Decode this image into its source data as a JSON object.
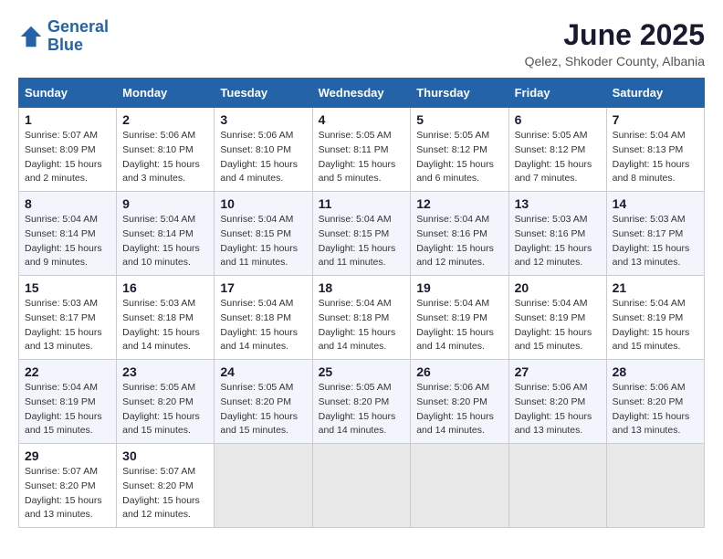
{
  "logo": {
    "line1": "General",
    "line2": "Blue"
  },
  "title": "June 2025",
  "subtitle": "Qelez, Shkoder County, Albania",
  "weekdays": [
    "Sunday",
    "Monday",
    "Tuesday",
    "Wednesday",
    "Thursday",
    "Friday",
    "Saturday"
  ],
  "weeks": [
    [
      {
        "day": "1",
        "sunrise": "5:07 AM",
        "sunset": "8:09 PM",
        "daylight": "15 hours and 2 minutes."
      },
      {
        "day": "2",
        "sunrise": "5:06 AM",
        "sunset": "8:10 PM",
        "daylight": "15 hours and 3 minutes."
      },
      {
        "day": "3",
        "sunrise": "5:06 AM",
        "sunset": "8:10 PM",
        "daylight": "15 hours and 4 minutes."
      },
      {
        "day": "4",
        "sunrise": "5:05 AM",
        "sunset": "8:11 PM",
        "daylight": "15 hours and 5 minutes."
      },
      {
        "day": "5",
        "sunrise": "5:05 AM",
        "sunset": "8:12 PM",
        "daylight": "15 hours and 6 minutes."
      },
      {
        "day": "6",
        "sunrise": "5:05 AM",
        "sunset": "8:12 PM",
        "daylight": "15 hours and 7 minutes."
      },
      {
        "day": "7",
        "sunrise": "5:04 AM",
        "sunset": "8:13 PM",
        "daylight": "15 hours and 8 minutes."
      }
    ],
    [
      {
        "day": "8",
        "sunrise": "5:04 AM",
        "sunset": "8:14 PM",
        "daylight": "15 hours and 9 minutes."
      },
      {
        "day": "9",
        "sunrise": "5:04 AM",
        "sunset": "8:14 PM",
        "daylight": "15 hours and 10 minutes."
      },
      {
        "day": "10",
        "sunrise": "5:04 AM",
        "sunset": "8:15 PM",
        "daylight": "15 hours and 11 minutes."
      },
      {
        "day": "11",
        "sunrise": "5:04 AM",
        "sunset": "8:15 PM",
        "daylight": "15 hours and 11 minutes."
      },
      {
        "day": "12",
        "sunrise": "5:04 AM",
        "sunset": "8:16 PM",
        "daylight": "15 hours and 12 minutes."
      },
      {
        "day": "13",
        "sunrise": "5:03 AM",
        "sunset": "8:16 PM",
        "daylight": "15 hours and 12 minutes."
      },
      {
        "day": "14",
        "sunrise": "5:03 AM",
        "sunset": "8:17 PM",
        "daylight": "15 hours and 13 minutes."
      }
    ],
    [
      {
        "day": "15",
        "sunrise": "5:03 AM",
        "sunset": "8:17 PM",
        "daylight": "15 hours and 13 minutes."
      },
      {
        "day": "16",
        "sunrise": "5:03 AM",
        "sunset": "8:18 PM",
        "daylight": "15 hours and 14 minutes."
      },
      {
        "day": "17",
        "sunrise": "5:04 AM",
        "sunset": "8:18 PM",
        "daylight": "15 hours and 14 minutes."
      },
      {
        "day": "18",
        "sunrise": "5:04 AM",
        "sunset": "8:18 PM",
        "daylight": "15 hours and 14 minutes."
      },
      {
        "day": "19",
        "sunrise": "5:04 AM",
        "sunset": "8:19 PM",
        "daylight": "15 hours and 14 minutes."
      },
      {
        "day": "20",
        "sunrise": "5:04 AM",
        "sunset": "8:19 PM",
        "daylight": "15 hours and 15 minutes."
      },
      {
        "day": "21",
        "sunrise": "5:04 AM",
        "sunset": "8:19 PM",
        "daylight": "15 hours and 15 minutes."
      }
    ],
    [
      {
        "day": "22",
        "sunrise": "5:04 AM",
        "sunset": "8:19 PM",
        "daylight": "15 hours and 15 minutes."
      },
      {
        "day": "23",
        "sunrise": "5:05 AM",
        "sunset": "8:20 PM",
        "daylight": "15 hours and 15 minutes."
      },
      {
        "day": "24",
        "sunrise": "5:05 AM",
        "sunset": "8:20 PM",
        "daylight": "15 hours and 15 minutes."
      },
      {
        "day": "25",
        "sunrise": "5:05 AM",
        "sunset": "8:20 PM",
        "daylight": "15 hours and 14 minutes."
      },
      {
        "day": "26",
        "sunrise": "5:06 AM",
        "sunset": "8:20 PM",
        "daylight": "15 hours and 14 minutes."
      },
      {
        "day": "27",
        "sunrise": "5:06 AM",
        "sunset": "8:20 PM",
        "daylight": "15 hours and 13 minutes."
      },
      {
        "day": "28",
        "sunrise": "5:06 AM",
        "sunset": "8:20 PM",
        "daylight": "15 hours and 13 minutes."
      }
    ],
    [
      {
        "day": "29",
        "sunrise": "5:07 AM",
        "sunset": "8:20 PM",
        "daylight": "15 hours and 13 minutes."
      },
      {
        "day": "30",
        "sunrise": "5:07 AM",
        "sunset": "8:20 PM",
        "daylight": "15 hours and 12 minutes."
      },
      null,
      null,
      null,
      null,
      null
    ]
  ],
  "labels": {
    "sunrise": "Sunrise: ",
    "sunset": "Sunset: ",
    "daylight": "Daylight: "
  }
}
